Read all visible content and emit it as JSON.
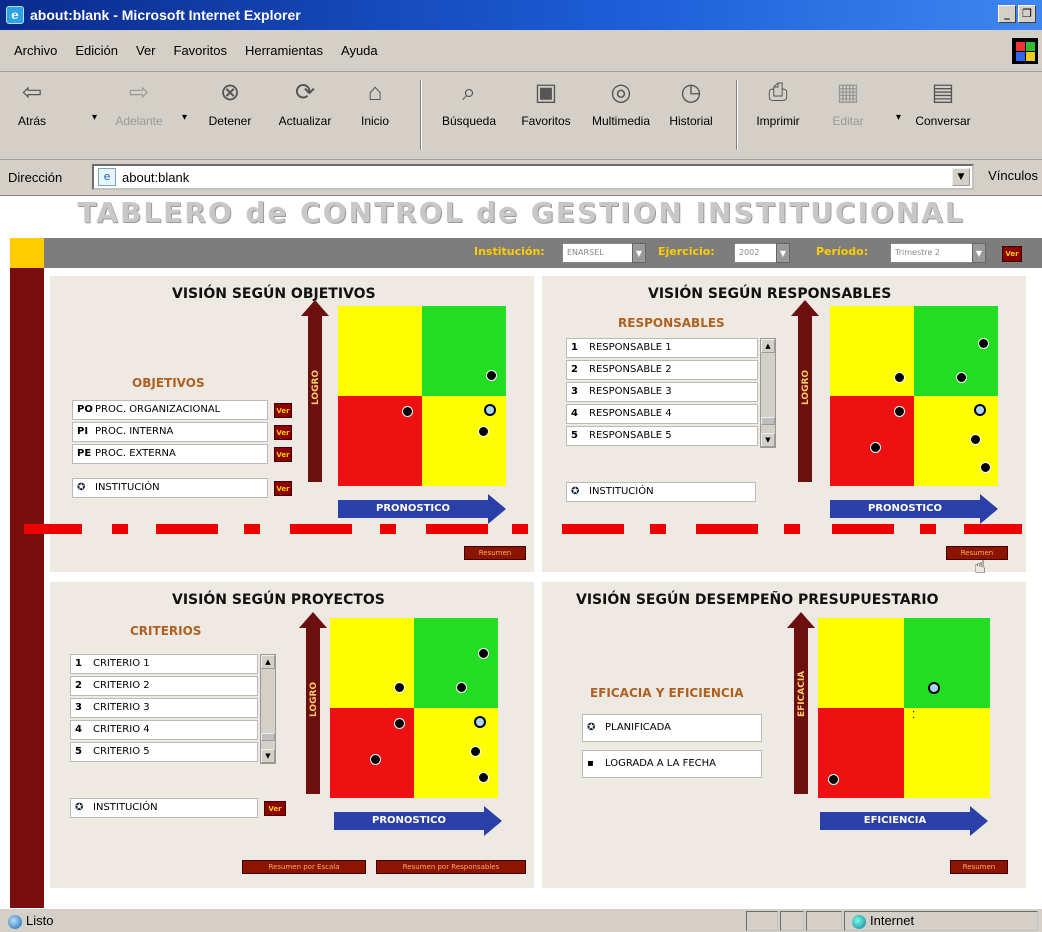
{
  "window": {
    "title": "about:blank - Microsoft Internet Explorer",
    "min": "_",
    "max": "❐"
  },
  "menu": [
    "Archivo",
    "Edición",
    "Ver",
    "Favoritos",
    "Herramientas",
    "Ayuda"
  ],
  "toolbar": {
    "back": "Atrás",
    "forward": "Adelante",
    "stop": "Detener",
    "refresh": "Actualizar",
    "home": "Inicio",
    "search": "Búsqueda",
    "favorites": "Favoritos",
    "media": "Multimedia",
    "history": "Historial",
    "print": "Imprimir",
    "edit": "Editar",
    "discuss": "Conversar"
  },
  "address": {
    "label": "Dirección",
    "value": "about:blank",
    "links": "Vínculos"
  },
  "page": {
    "title": "TABLERO de CONTROL de GESTION INSTITUCIONAL",
    "controls": {
      "institucion_label": "Institución:",
      "institucion_value": "ENARSEL",
      "ejercicio_label": "Ejercicio:",
      "ejercicio_value": "2002",
      "periodo_label": "Período:",
      "periodo_value": "Trimestre 2",
      "ver": "Ver"
    },
    "objetivos": {
      "title": "VISIÓN SEGÚN OBJETIVOS",
      "subtitle": "OBJETIVOS",
      "rows": [
        {
          "code": "PO",
          "label": "PROC. ORGANIZACIONAL"
        },
        {
          "code": "PI",
          "label": "PROC. INTERNA"
        },
        {
          "code": "PE",
          "label": "PROC. EXTERNA"
        }
      ],
      "institucion": "INSTITUCIÓN",
      "y_label": "LOGRO",
      "x_label": "PRONOSTICO",
      "resumen": "Resumen"
    },
    "responsables": {
      "title": "VISIÓN SEGÚN RESPONSABLES",
      "subtitle": "RESPONSABLES",
      "rows": [
        {
          "code": "1",
          "label": "RESPONSABLE 1"
        },
        {
          "code": "2",
          "label": "RESPONSABLE 2"
        },
        {
          "code": "3",
          "label": "RESPONSABLE 3"
        },
        {
          "code": "4",
          "label": "RESPONSABLE 4"
        },
        {
          "code": "5",
          "label": "RESPONSABLE 5"
        }
      ],
      "institucion": "INSTITUCIÓN",
      "y_label": "LOGRO",
      "x_label": "PRONOSTICO",
      "resumen": "Resumen"
    },
    "proyectos": {
      "title": "VISIÓN SEGÚN PROYECTOS",
      "subtitle": "CRITERIOS",
      "rows": [
        {
          "code": "1",
          "label": "CRITERIO 1"
        },
        {
          "code": "2",
          "label": "CRITERIO 2"
        },
        {
          "code": "3",
          "label": "CRITERIO 3"
        },
        {
          "code": "4",
          "label": "CRITERIO 4"
        },
        {
          "code": "5",
          "label": "CRITERIO 5"
        }
      ],
      "institucion": "INSTITUCIÓN",
      "y_label": "LOGRO",
      "x_label": "PRONOSTICO",
      "resumen_a": "Resumen por Escala",
      "resumen_b": "Resumen por Responsables"
    },
    "presupuestario": {
      "title": "VISIÓN SEGÚN DESEMPEÑO PRESUPUESTARIO",
      "subtitle": "EFICACIA Y EFICIENCIA",
      "legend_planned": "PLANIFICADA",
      "legend_achieved": "LOGRADA A LA FECHA",
      "y_label": "EFICACIA",
      "x_label": "EFICIENCIA",
      "resumen": "Resumen"
    }
  },
  "status": {
    "text": "Listo",
    "zone": "Internet"
  }
}
